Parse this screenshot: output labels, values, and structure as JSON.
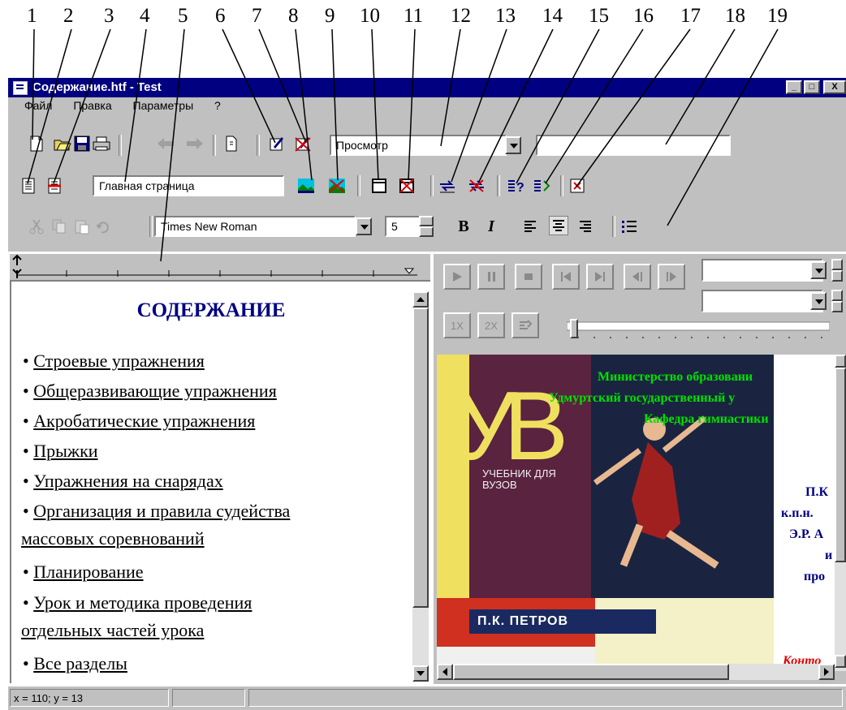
{
  "callout_numbers": [
    "1",
    "2",
    "3",
    "4",
    "5",
    "6",
    "7",
    "8",
    "9",
    "10",
    "11",
    "12",
    "13",
    "14",
    "15",
    "16",
    "17",
    "18",
    "19"
  ],
  "window": {
    "title": "Содержание.htf - Test",
    "buttons": {
      "minimize": "_",
      "maximize": "□",
      "close": "X"
    }
  },
  "menu": [
    {
      "label": "Файл"
    },
    {
      "label": "Правка"
    },
    {
      "label": "Параметры"
    },
    {
      "label": "?"
    }
  ],
  "toolbar1": {
    "mode_combo": "Просмотр",
    "search_field": ""
  },
  "toolbar2": {
    "page_field": "Главная страница"
  },
  "format_toolbar": {
    "font_name": "Times New Roman",
    "font_size": "5",
    "bold_label": "B",
    "italic_label": "I"
  },
  "document": {
    "heading": "СОДЕРЖАНИЕ",
    "items": [
      "Строевые упражнения",
      "Общеразвивающие упражнения",
      "Акробатические упражнения",
      "Прыжки",
      "Упражнения на снарядах",
      "Организация и правила судейства ",
      "массовых соревнований",
      "Планирование",
      "Урок и методика проведения ",
      "отдельных частей урока",
      "Все разделы"
    ],
    "bullet": "•"
  },
  "media": {
    "speed_1x": "1X",
    "speed_2x": "2X",
    "progress": 0.0
  },
  "book_preview": {
    "logo_letters": "УВ",
    "subtitle": "УЧЕБНИК ДЛЯ ВУЗОВ",
    "author_band": "П.К. ПЕТРОВ",
    "header_lines": [
      "Министерство образовани",
      "Удмуртский государственный у",
      "Кафедра гимнастики"
    ],
    "right_lines": [
      "П.К",
      "к.п.н.",
      "Э.Р. А",
      "и",
      "про"
    ],
    "red_text": "Конто"
  },
  "status": {
    "coords": "x = 110;  y = 13"
  },
  "colors": {
    "titlebar": "#000080",
    "face": "#c0c0c0",
    "heading": "#000080",
    "cover_purple": "#5a2340",
    "cover_yellow": "#f0e060"
  }
}
